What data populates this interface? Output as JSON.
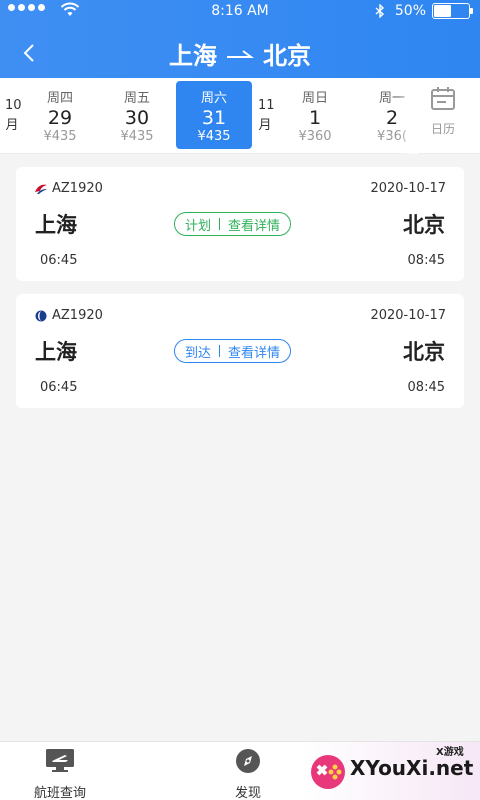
{
  "status_bar": {
    "time": "8:16 AM",
    "battery": "50%",
    "battery_level": 0.5
  },
  "header": {
    "from": "上海",
    "to": "北京",
    "back_icon": "back-chevron-icon",
    "color": "#2f86f1"
  },
  "date_strip": {
    "month_oct": "10\n月",
    "month_nov": "11\n月",
    "days": [
      {
        "weekday": "周四",
        "day": "29",
        "price": "¥435"
      },
      {
        "weekday": "周五",
        "day": "30",
        "price": "¥435"
      },
      {
        "weekday": "周六",
        "day": "31",
        "price": "¥435",
        "selected": true
      },
      {
        "weekday": "周日",
        "day": "1",
        "price": "¥360"
      },
      {
        "weekday": "周一",
        "day": "2",
        "price": "¥36("
      }
    ],
    "calendar_label": "日历"
  },
  "flights": [
    {
      "airline_icon": "china-eastern-logo-icon",
      "flight_no": "AZ1920",
      "date": "2020-10-17",
      "from": "上海",
      "to": "北京",
      "status": "计划",
      "detail": "查看详情",
      "dep_time": "06:45",
      "arr_time": "08:45",
      "status_color": "#2fb15a"
    },
    {
      "airline_icon": "china-southern-logo-icon",
      "flight_no": "AZ1920",
      "date": "2020-10-17",
      "from": "上海",
      "to": "北京",
      "status": "到达",
      "detail": "查看详情",
      "dep_time": "06:45",
      "arr_time": "08:45",
      "status_color": "#2f86f1"
    }
  ],
  "tabbar": {
    "tabs": [
      {
        "label": "航班查询",
        "icon": "flight-board-icon"
      },
      {
        "label": "发现",
        "icon": "compass-icon"
      }
    ]
  },
  "watermark": {
    "text": "XYouXi.net",
    "small": "X游戏"
  }
}
